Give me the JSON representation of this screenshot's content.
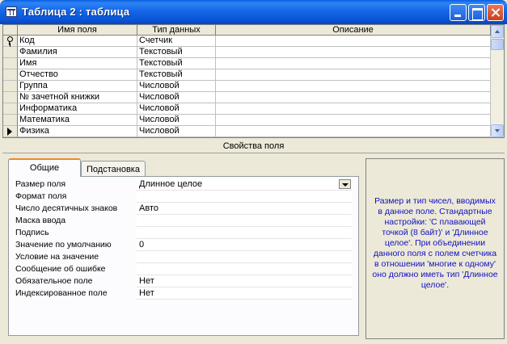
{
  "window": {
    "title": "Таблица 2 : таблица",
    "accent_color": "#0A5FE0"
  },
  "grid": {
    "columns": [
      "Имя поля",
      "Тип данных",
      "Описание"
    ],
    "rows": [
      {
        "name": "Код",
        "type": "Счетчик",
        "description": "",
        "marker": "key-icon"
      },
      {
        "name": "Фамилия",
        "type": "Текстовый",
        "description": ""
      },
      {
        "name": "Имя",
        "type": "Текстовый",
        "description": ""
      },
      {
        "name": "Отчество",
        "type": "Текстовый",
        "description": ""
      },
      {
        "name": "Группа",
        "type": "Числовой",
        "description": ""
      },
      {
        "name": "№ зачетной книжки",
        "type": "Числовой",
        "description": ""
      },
      {
        "name": "Информатика",
        "type": "Числовой",
        "description": ""
      },
      {
        "name": "Математика",
        "type": "Числовой",
        "description": ""
      },
      {
        "name": "Физика",
        "type": "Числовой",
        "description": "",
        "marker": "current-row-arrow-icon"
      }
    ]
  },
  "properties": {
    "title": "Свойства поля",
    "tabs": [
      "Общие",
      "Подстановка"
    ],
    "active_tab": "Общие",
    "fields": [
      {
        "label": "Размер поля",
        "value": "Длинное целое",
        "has_dropdown": true
      },
      {
        "label": "Формат поля",
        "value": ""
      },
      {
        "label": "Число десятичных знаков",
        "value": "Авто"
      },
      {
        "label": "Маска ввода",
        "value": ""
      },
      {
        "label": "Подпись",
        "value": ""
      },
      {
        "label": "Значение по умолчанию",
        "value": "0"
      },
      {
        "label": "Условие на значение",
        "value": ""
      },
      {
        "label": "Сообщение об ошибке",
        "value": ""
      },
      {
        "label": "Обязательное поле",
        "value": "Нет"
      },
      {
        "label": "Индексированное поле",
        "value": "Нет"
      }
    ],
    "help_text": "Размер и тип чисел, вводимых в данное поле. Стандартные настройки: 'С плавающей точкой (8 байт)' и 'Длинное целое'.  При объединении данного поля с полем счетчика в отношении 'многие к одному' оно должно иметь тип 'Длинное целое'.",
    "help_color": "#1010C0"
  }
}
